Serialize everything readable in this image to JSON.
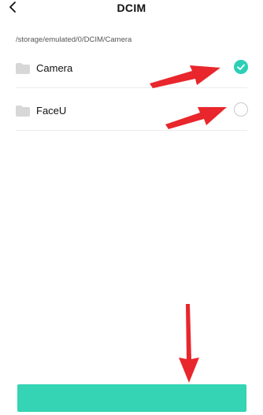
{
  "header": {
    "title": "DCIM"
  },
  "path": "/storage/emulated/0/DCIM/Camera",
  "folders": [
    {
      "label": "Camera",
      "selected": true
    },
    {
      "label": "FaceU",
      "selected": false
    }
  ],
  "colors": {
    "accent": "#2ccfb5",
    "button": "#35d4b4",
    "arrow": "#e8262c"
  },
  "icons": {
    "back": "chevron-left-icon",
    "folder": "folder-icon",
    "check": "check-icon"
  },
  "bottom_button": {
    "label": ""
  }
}
